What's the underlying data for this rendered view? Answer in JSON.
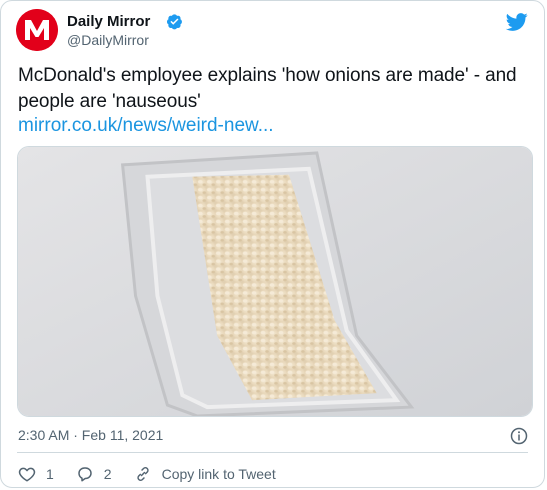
{
  "account": {
    "name": "Daily Mirror",
    "handle": "@DailyMirror",
    "logo_letter": "M",
    "brand_color": "#e2001a"
  },
  "tweet": {
    "text": "McDonald's employee explains 'how onions are made' - and people are 'nauseous'",
    "link": "mirror.co.uk/news/weird-new...",
    "timestamp": "2:30 AM · Feb 11, 2021"
  },
  "actions": {
    "likes": "1",
    "replies": "2",
    "copy_link_label": "Copy link to Tweet"
  },
  "icons": {
    "verified": "verified-badge-icon",
    "twitter": "twitter-bird-icon",
    "info": "info-icon",
    "like": "heart-icon",
    "reply": "reply-bubble-icon",
    "copy": "link-icon"
  },
  "colors": {
    "accent": "#1d9bf0",
    "link": "#1b95e0",
    "muted": "#536471"
  }
}
